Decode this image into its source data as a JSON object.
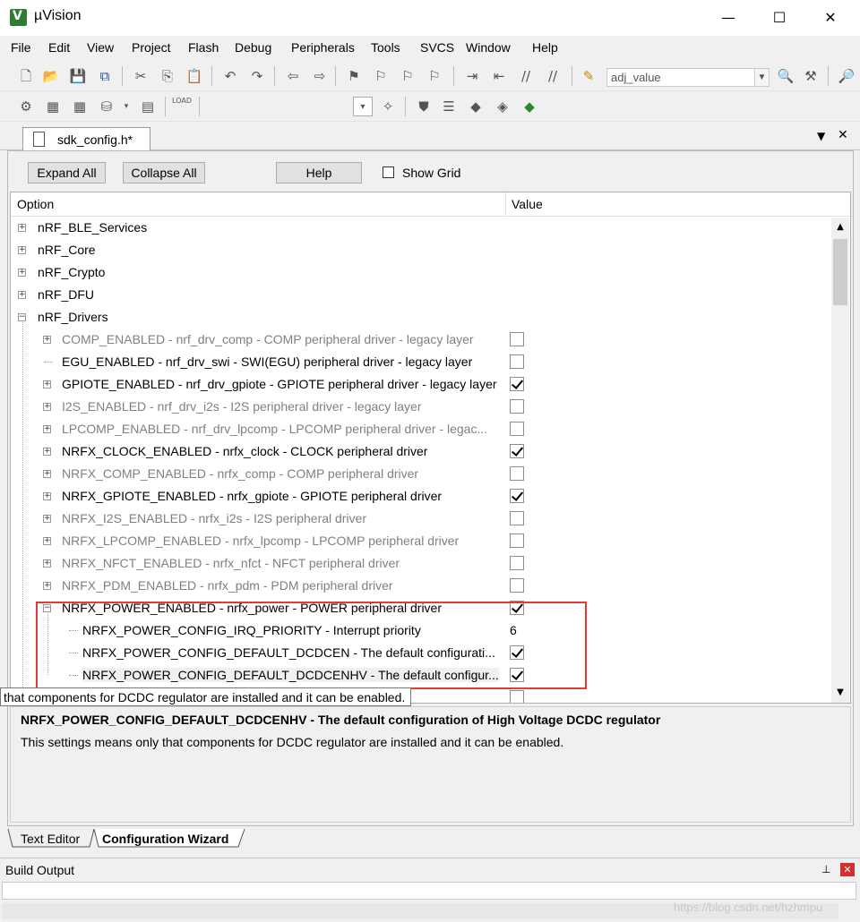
{
  "window": {
    "title": "µVision",
    "min": "—",
    "max": "☐",
    "close": "✕"
  },
  "menu": [
    "File",
    "Edit",
    "View",
    "Project",
    "Flash",
    "Debug",
    "Peripherals",
    "Tools",
    "SVCS",
    "Window",
    "Help"
  ],
  "toolbar": {
    "target_combo": "adj_value"
  },
  "doc_tab": {
    "label": "sdk_config.h*"
  },
  "wizard": {
    "buttons": {
      "expand": "Expand All",
      "collapse": "Collapse All",
      "help": "Help"
    },
    "show_grid": "Show Grid",
    "columns": {
      "option": "Option",
      "value": "Value"
    },
    "rows": [
      {
        "text": "nRF_BLE_Services",
        "level": 0,
        "expander": "+",
        "dim": false,
        "value": ""
      },
      {
        "text": "nRF_Core",
        "level": 0,
        "expander": "+",
        "dim": false,
        "value": ""
      },
      {
        "text": "nRF_Crypto",
        "level": 0,
        "expander": "+",
        "dim": false,
        "value": ""
      },
      {
        "text": "nRF_DFU",
        "level": 0,
        "expander": "+",
        "dim": false,
        "value": ""
      },
      {
        "text": "nRF_Drivers",
        "level": 0,
        "expander": "−",
        "dim": false,
        "value": ""
      },
      {
        "text": "COMP_ENABLED - nrf_drv_comp - COMP peripheral driver - legacy layer",
        "level": 1,
        "expander": "+",
        "dim": true,
        "value": "unchecked"
      },
      {
        "text": "EGU_ENABLED  - nrf_drv_swi - SWI(EGU) peripheral driver - legacy layer",
        "level": 1,
        "expander": "",
        "dim": false,
        "value": "unchecked"
      },
      {
        "text": "GPIOTE_ENABLED - nrf_drv_gpiote - GPIOTE peripheral driver - legacy layer",
        "level": 1,
        "expander": "+",
        "dim": false,
        "value": "checked"
      },
      {
        "text": "I2S_ENABLED - nrf_drv_i2s - I2S peripheral driver - legacy layer",
        "level": 1,
        "expander": "+",
        "dim": true,
        "value": "unchecked"
      },
      {
        "text": "LPCOMP_ENABLED - nrf_drv_lpcomp - LPCOMP peripheral driver - legac...",
        "level": 1,
        "expander": "+",
        "dim": true,
        "value": "unchecked"
      },
      {
        "text": "NRFX_CLOCK_ENABLED - nrfx_clock - CLOCK peripheral driver",
        "level": 1,
        "expander": "+",
        "dim": false,
        "value": "checked"
      },
      {
        "text": "NRFX_COMP_ENABLED - nrfx_comp - COMP peripheral driver",
        "level": 1,
        "expander": "+",
        "dim": true,
        "value": "unchecked"
      },
      {
        "text": "NRFX_GPIOTE_ENABLED - nrfx_gpiote - GPIOTE peripheral driver",
        "level": 1,
        "expander": "+",
        "dim": false,
        "value": "checked"
      },
      {
        "text": "NRFX_I2S_ENABLED - nrfx_i2s - I2S peripheral driver",
        "level": 1,
        "expander": "+",
        "dim": true,
        "value": "unchecked"
      },
      {
        "text": "NRFX_LPCOMP_ENABLED - nrfx_lpcomp - LPCOMP peripheral driver",
        "level": 1,
        "expander": "+",
        "dim": true,
        "value": "unchecked"
      },
      {
        "text": "NRFX_NFCT_ENABLED - nrfx_nfct - NFCT peripheral driver",
        "level": 1,
        "expander": "+",
        "dim": true,
        "value": "unchecked"
      },
      {
        "text": "NRFX_PDM_ENABLED - nrfx_pdm - PDM peripheral driver",
        "level": 1,
        "expander": "+",
        "dim": true,
        "value": "unchecked"
      },
      {
        "text": "NRFX_POWER_ENABLED - nrfx_power - POWER peripheral driver",
        "level": 1,
        "expander": "−",
        "dim": false,
        "value": "checked"
      },
      {
        "text": "NRFX_POWER_CONFIG_IRQ_PRIORITY  - Interrupt priority",
        "level": 2,
        "expander": "",
        "dim": false,
        "value": "6"
      },
      {
        "text": "NRFX_POWER_CONFIG_DEFAULT_DCDCEN  - The default configurati...",
        "level": 2,
        "expander": "",
        "dim": false,
        "value": "checked"
      },
      {
        "text": "NRFX_POWER_CONFIG_DEFAULT_DCDCENHV  - The default configur...",
        "level": 2,
        "expander": "",
        "dim": false,
        "value": "checked",
        "selected": true
      },
      {
        "text": "",
        "level": 1,
        "expander": "",
        "dim": true,
        "value": "unchecked"
      }
    ],
    "tooltip": "that components for DCDC regulator are installed and it can be enabled.",
    "description": {
      "title": "NRFX_POWER_CONFIG_DEFAULT_DCDCENHV  - The default configuration of High Voltage DCDC regulator",
      "body": "This settings means only that components for DCDC regulator are installed and it can be enabled."
    }
  },
  "bottom_tabs": [
    "Text Editor",
    "Configuration Wizard"
  ],
  "build_output": {
    "title": "Build Output"
  },
  "watermark": "https://blog.csdn.net/hzhmpu",
  "colors": {
    "highlight_box": "#e53935",
    "dim_text": "#808080"
  }
}
